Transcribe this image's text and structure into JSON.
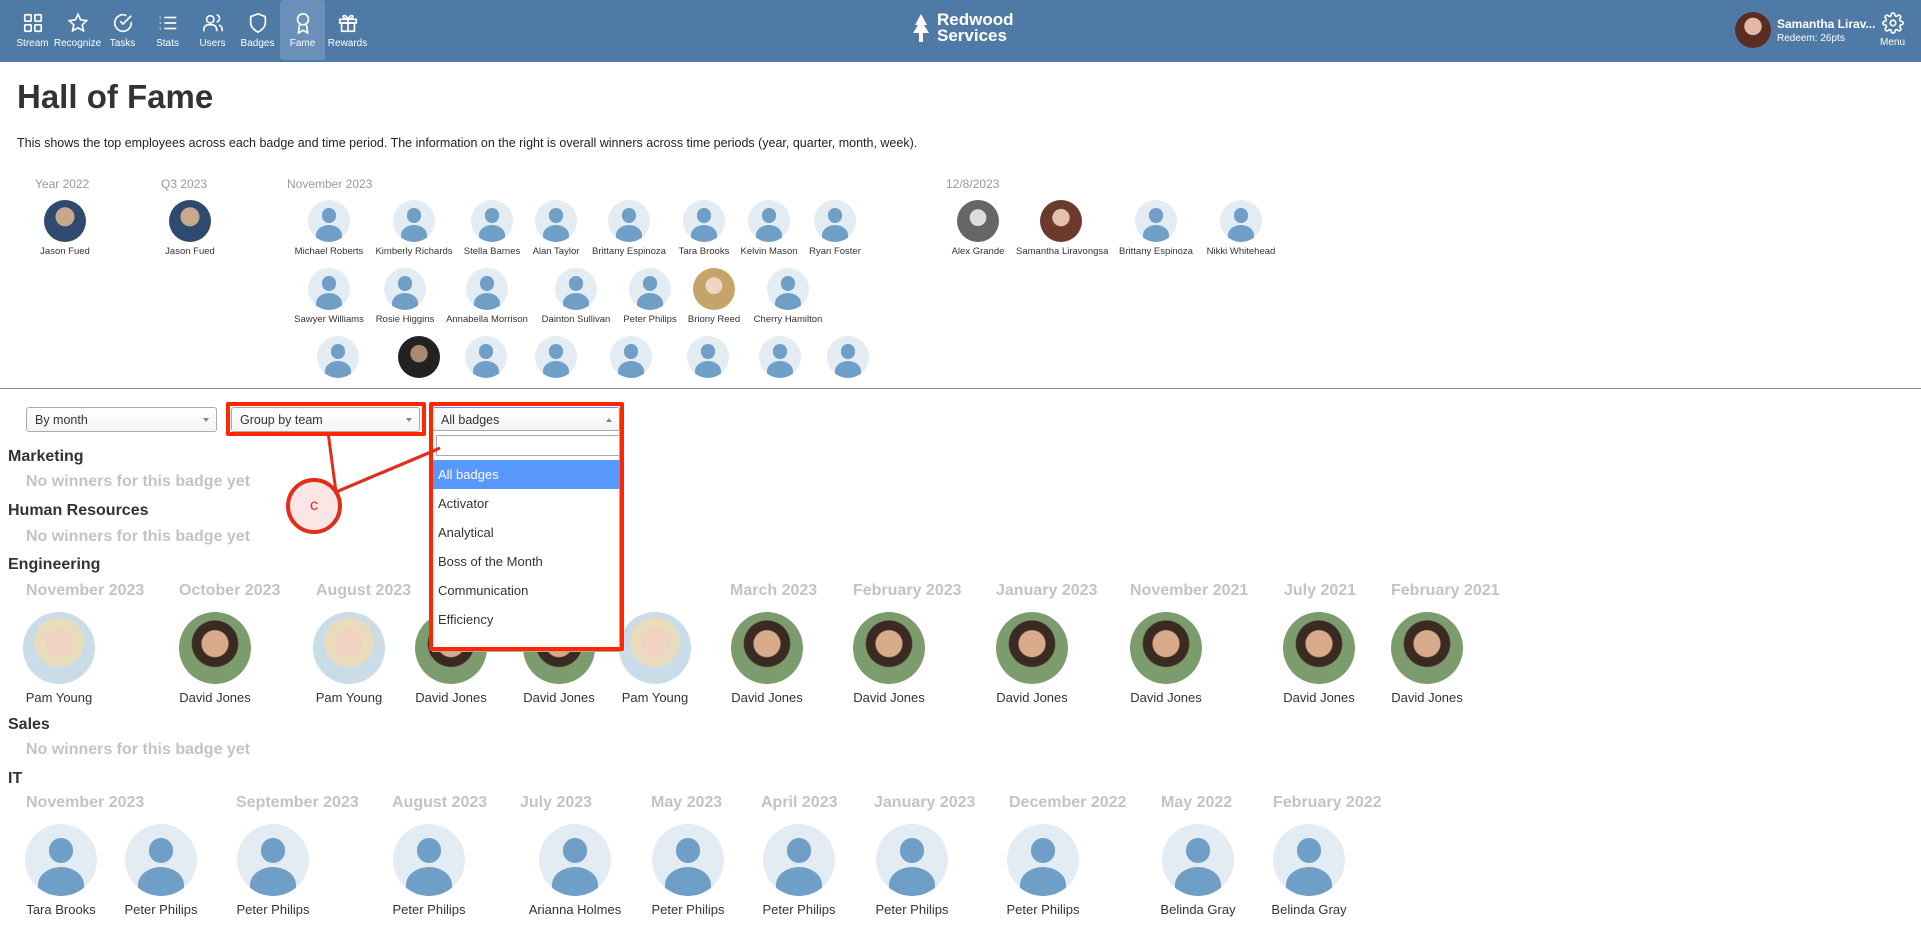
{
  "nav": {
    "items": [
      {
        "label": "Stream",
        "icon": "grid-icon"
      },
      {
        "label": "Recognize",
        "icon": "star-icon"
      },
      {
        "label": "Tasks",
        "icon": "check-circle-icon"
      },
      {
        "label": "Stats",
        "icon": "list-icon"
      },
      {
        "label": "Users",
        "icon": "users-icon"
      },
      {
        "label": "Badges",
        "icon": "shield-icon"
      },
      {
        "label": "Fame",
        "icon": "award-icon",
        "active": true
      },
      {
        "label": "Rewards",
        "icon": "gift-icon"
      }
    ],
    "logo_line1": "Redwood",
    "logo_line2": "Services",
    "user_name": "Samantha Lirav...",
    "user_points": "Redeem: 26pts",
    "menu_label": "Menu"
  },
  "page": {
    "title": "Hall of Fame",
    "description": "This shows the top employees across each badge and time period. The information on the right is overall winners across time periods (year, quarter, month, week)."
  },
  "hall": {
    "year_label": "Year 2022",
    "year_winner": "Jason Fued",
    "quarter_label": "Q3 2023",
    "quarter_winner": "Jason Fued",
    "month_label": "November 2023",
    "month_row1": [
      "Michael Roberts",
      "Kimberly Richards",
      "Stella Barnes",
      "Alan Taylor",
      "Brittany Espinoza",
      "Tara Brooks",
      "Kelvin Mason",
      "Ryan Foster"
    ],
    "month_row2": [
      "Sawyer Williams",
      "Rosie Higgins",
      "Annabella Morrison",
      "Dainton Sullivan",
      "Peter Philips",
      "Briony Reed",
      "Cherry Hamilton"
    ],
    "week_label": "12/8/2023",
    "week_winners": [
      "Alex Grande",
      "Samantha Liravongsa",
      "Brittany Espinoza",
      "Nikki Whitehead"
    ]
  },
  "filters": {
    "period": "By month",
    "grouping": "Group by team",
    "badge": "All badges"
  },
  "dropdown": {
    "options": [
      "All badges",
      "Activator",
      "Analytical",
      "Boss of the Month",
      "Communication",
      "Efficiency"
    ]
  },
  "callout": {
    "label": "c"
  },
  "teams": {
    "marketing": {
      "name": "Marketing",
      "empty": "No winners for this badge yet"
    },
    "hr": {
      "name": "Human Resources",
      "empty": "No winners for this badge yet"
    },
    "engineering": {
      "name": "Engineering",
      "months": [
        "November 2023",
        "October 2023",
        "August 2023",
        "March 2023",
        "February 2023",
        "January 2023",
        "November 2021",
        "July 2021",
        "February 2021"
      ],
      "winners": [
        "Pam Young",
        "David Jones",
        "Pam Young",
        "David Jones",
        "David Jones",
        "Pam Young",
        "David Jones",
        "David Jones",
        "David Jones",
        "David Jones",
        "David Jones",
        "David Jones"
      ]
    },
    "sales": {
      "name": "Sales",
      "empty": "No winners for this badge yet"
    },
    "it": {
      "name": "IT",
      "months": [
        "November 2023",
        "September 2023",
        "August 2023",
        "July 2023",
        "May 2023",
        "April 2023",
        "January 2023",
        "December 2022",
        "May 2022",
        "February 2022"
      ],
      "winners": [
        "Tara Brooks",
        "Peter Philips",
        "Peter Philips",
        "Peter Philips",
        "Arianna Holmes",
        "Peter Philips",
        "Peter Philips",
        "Peter Philips",
        "Peter Philips",
        "Belinda Gray",
        "Belinda Gray"
      ]
    }
  },
  "colors": {
    "nav_bg": "#4f7aa6",
    "highlight": "#ff2600",
    "selected_option": "#5897fb"
  }
}
